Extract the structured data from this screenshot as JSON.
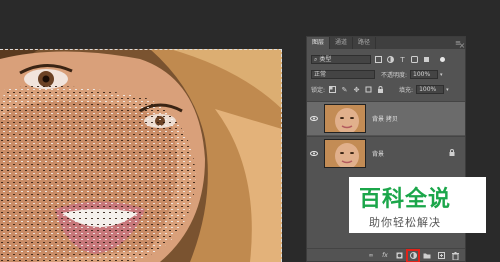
{
  "panel": {
    "tabs": [
      {
        "label": "图层",
        "active": true
      },
      {
        "label": "通道",
        "active": false
      },
      {
        "label": "路径",
        "active": false
      }
    ],
    "filter": {
      "label": "类型"
    },
    "blend_mode": "正常",
    "opacity": {
      "label": "不透明度:",
      "value": "100%"
    },
    "lock_label": "锁定:",
    "fill": {
      "label": "填充:",
      "value": "100%"
    },
    "layers": [
      {
        "name": "背景 拷贝",
        "selected": true,
        "visible": true,
        "locked": false
      },
      {
        "name": "背景",
        "selected": false,
        "visible": true,
        "locked": true
      }
    ],
    "footer_icons": [
      "link-icon",
      "fx-icon",
      "mask-icon",
      "adjustment-icon",
      "folder-icon",
      "new-layer-icon",
      "trash-icon"
    ],
    "highlighted_icon": "adjustment-icon"
  },
  "watermark": {
    "title": "百科全说",
    "subtitle": "助你轻松解决",
    "color": "#1ba64a"
  },
  "colors": {
    "app_bg": "#2a2a2a",
    "panel_bg": "#535353",
    "selected_layer": "#6b6b6b",
    "highlight": "#e2231a"
  }
}
